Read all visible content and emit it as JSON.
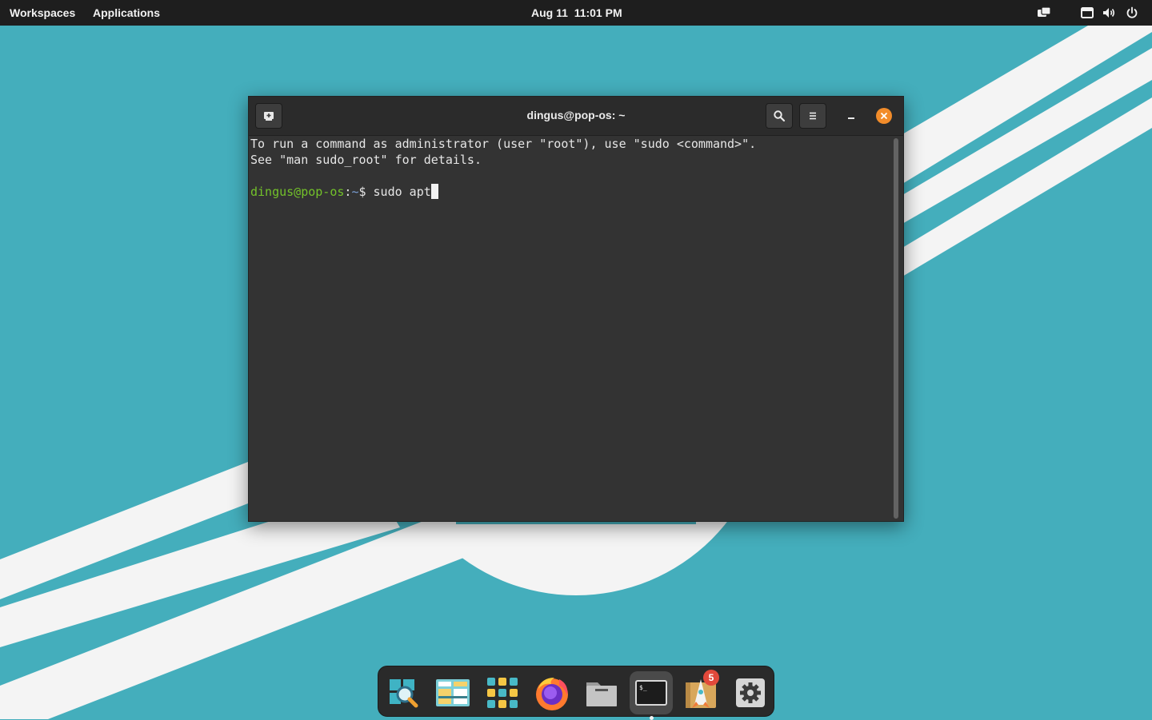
{
  "top_panel": {
    "workspaces_label": "Workspaces",
    "applications_label": "Applications",
    "date": "Aug 11",
    "time": "11:01 PM",
    "tray_icons": [
      "notifications-icon",
      "keyboard-icon",
      "volume-icon",
      "power-icon"
    ]
  },
  "terminal": {
    "title": "dingus@pop-os: ~",
    "lines": [
      "To run a command as administrator (user \"root\"), use \"sudo <command>\".",
      "See \"man sudo_root\" for details."
    ],
    "prompt_user": "dingus@pop-os",
    "prompt_sep": ":",
    "prompt_path": "~",
    "prompt_symbol": "$ ",
    "command": "sudo apt",
    "colors": {
      "user": "#73c22a",
      "path": "#7a9fd6",
      "background": "#333333"
    }
  },
  "dock": {
    "items": [
      "search-app-icon",
      "workspaces-app-icon",
      "app-grid-icon",
      "firefox-icon",
      "files-icon",
      "terminal-icon",
      "pop-shop-icon",
      "settings-icon"
    ],
    "shop_badge": "5",
    "active_item": "terminal-icon"
  },
  "colors": {
    "wallpaper": "#44aebc",
    "accent": "#f28c2a"
  }
}
